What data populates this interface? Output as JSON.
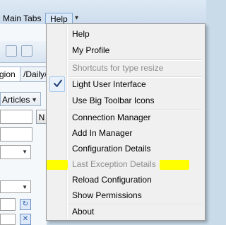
{
  "menubar": {
    "main_tabs_label": "Main Tabs",
    "help_label": "Help"
  },
  "background": {
    "tab_region_label": "gion",
    "tab_daily_label": "/Daily/",
    "articles_label": "Articles",
    "n_button_label": "N"
  },
  "help_menu": {
    "items": [
      {
        "label": "Help",
        "enabled": true
      },
      {
        "label": "My Profile",
        "enabled": true
      },
      {
        "label": "Shortcuts for type resize",
        "enabled": false
      },
      {
        "label": "Light User Interface",
        "enabled": true,
        "checked": true
      },
      {
        "label": "Use Big Toolbar Icons",
        "enabled": true
      },
      {
        "label": "Connection Manager",
        "enabled": true
      },
      {
        "label": "Add In Manager",
        "enabled": true
      },
      {
        "label": "Configuration Details",
        "enabled": true
      },
      {
        "label": "Last Exception Details",
        "enabled": false,
        "highlighted": true
      },
      {
        "label": "Reload Configuration",
        "enabled": true
      },
      {
        "label": "Show Permissions",
        "enabled": true
      },
      {
        "label": "About",
        "enabled": true
      }
    ]
  },
  "colors": {
    "highlight": "#ffff00",
    "disabled_text": "#8d8d8d",
    "menu_bg": "#f0f0f0",
    "app_bg": "#c9dbe9"
  },
  "icons": [
    "chevron-down-icon",
    "check-icon",
    "dropdown-arrow-icon",
    "refresh-icon",
    "close-icon"
  ]
}
